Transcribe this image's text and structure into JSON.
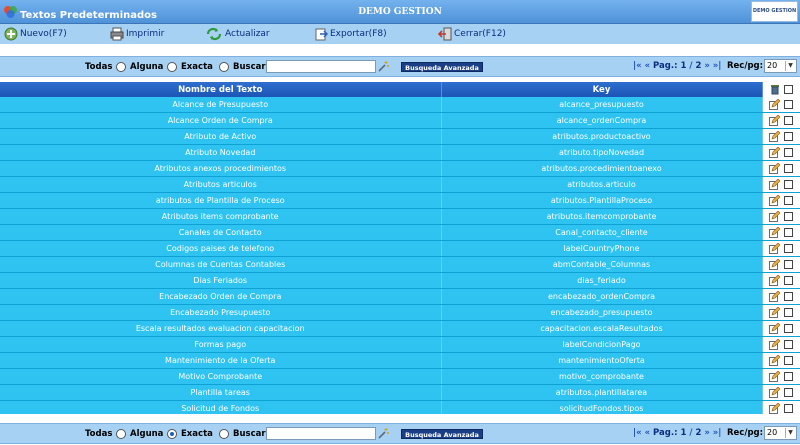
{
  "window": {
    "title": "Textos Predeterminados",
    "company": "DEMO GESTION",
    "logo_text": "DEMO GESTION"
  },
  "toolbar": {
    "nuevo": "Nuevo(F7)",
    "imprimir": "Imprimir",
    "actualizar": "Actualizar",
    "exportar": "Exportar(F8)",
    "cerrar": "Cerrar(F12)"
  },
  "search_top": {
    "todas": "Todas",
    "alguna": "Alguna",
    "exacta": "Exacta",
    "buscar": "Buscar",
    "value": "",
    "selected_mode": "none",
    "advanced_label": "Busqueda Avanzada",
    "page_label": "Pag.:",
    "page_current": "1",
    "page_total": "2",
    "rec_label": "Rec/pg:",
    "rec_value": "20"
  },
  "search_bottom": {
    "todas": "Todas",
    "alguna": "Alguna",
    "exacta": "Exacta",
    "buscar": "Buscar",
    "value": "",
    "selected_mode": "alguna",
    "advanced_label": "Busqueda Avanzada",
    "page_label": "Pag.:",
    "page_current": "1",
    "page_total": "2",
    "rec_label": "Rec/pg:",
    "rec_value": "20"
  },
  "table": {
    "headers": [
      "Nombre del Texto",
      "Key"
    ],
    "rows": [
      [
        "Alcance de Presupuesto",
        "alcance_presupuesto"
      ],
      [
        "Alcance Orden de Compra",
        "alcance_ordenCompra"
      ],
      [
        "Atributo de Activo",
        "atributos.productoactivo"
      ],
      [
        "Atributo Novedad",
        "atributo.tipoNovedad"
      ],
      [
        "Atributos anexos procedimientos",
        "atributos.procedimientoanexo"
      ],
      [
        "Atributos articulos",
        "atributos.articulo"
      ],
      [
        "atributos de Plantilla de Proceso",
        "atributos.PlantillaProceso"
      ],
      [
        "Atributos items comprobante",
        "atributos.itemcomprobante"
      ],
      [
        "Canales de Contacto",
        "Canal_contacto_cliente"
      ],
      [
        "Codigos paises de telefono",
        "labelCountryPhone"
      ],
      [
        "Columnas de Cuentas Contables",
        "abmContable_Columnas"
      ],
      [
        "Dias Feriados",
        "dias_feriado"
      ],
      [
        "Encabezado Orden de Compra",
        "encabezado_ordenCompra"
      ],
      [
        "Encabezado Presupuesto",
        "encabezado_presupuesto"
      ],
      [
        "Escala resultados evaluacion capacitacion",
        "capacitacion.escalaResultados"
      ],
      [
        "Formas pago",
        "labelCondicionPago"
      ],
      [
        "Mantenimiento de la Oferta",
        "mantenimientoOferta"
      ],
      [
        "Motivo Comprobante",
        "motivo_comprobante"
      ],
      [
        "Plantilla tareas",
        "atributos.plantillatarea"
      ],
      [
        "Solicitud de Fondos",
        "solicitudFondos.tipos"
      ]
    ]
  },
  "colors": {
    "title_bar": "#4f92d8",
    "toolbar_bg": "#a7d1f3",
    "header_bg": "#1b55b5",
    "row_bg": "#2ec3f1",
    "accent_link": "#0b2d80"
  }
}
